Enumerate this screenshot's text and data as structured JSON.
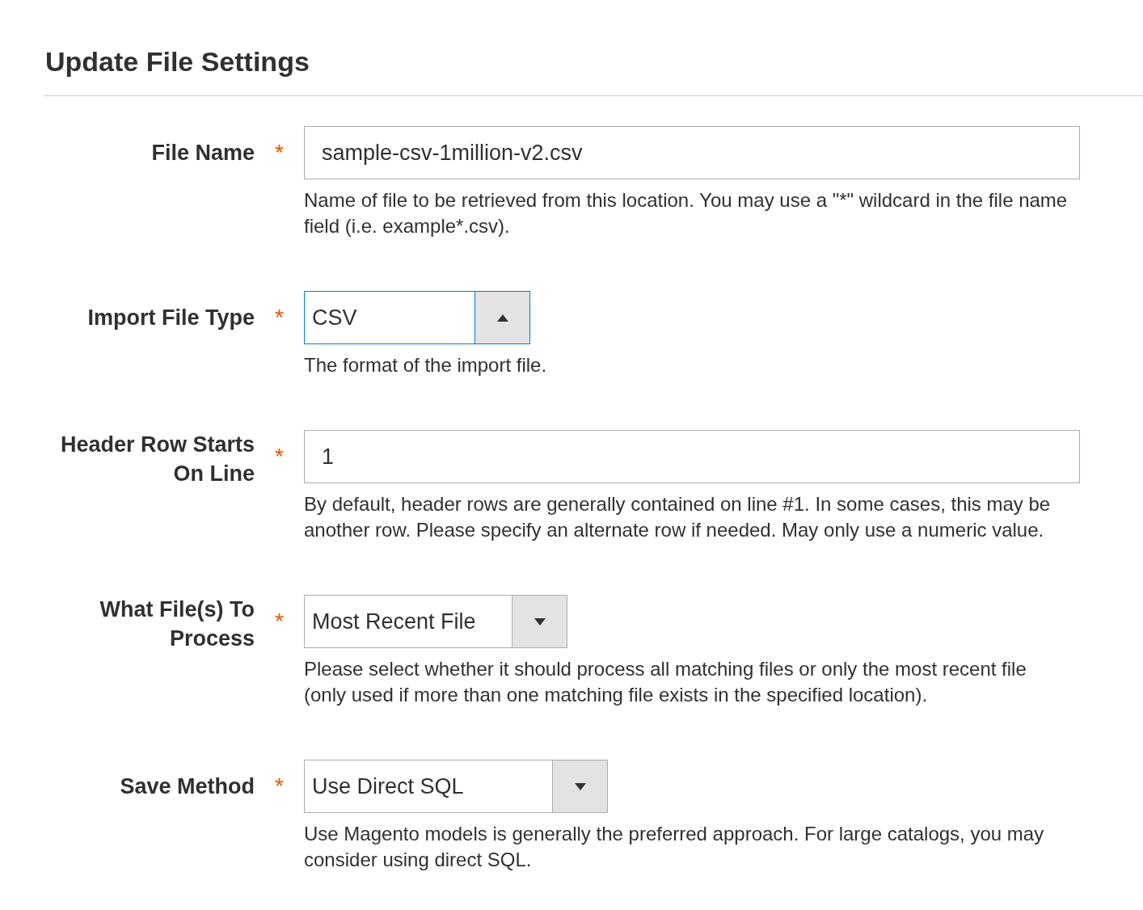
{
  "section": {
    "title": "Update File Settings"
  },
  "fields": [
    {
      "kind": "text",
      "label": "File Name",
      "required": "*",
      "value": "sample-csv-1million-v2.csv",
      "note": "Name of file to be retrieved from this location. You may use a \"*\" wildcard in the file name field (i.e. example*.csv)."
    },
    {
      "kind": "select",
      "label": "Import File Type",
      "required": "*",
      "value": "CSV",
      "expanded": true,
      "note": "The format of the import file."
    },
    {
      "kind": "text",
      "label": "Header Row Starts On Line",
      "required": "*",
      "value": "1",
      "note": "By default, header rows are generally contained on line #1. In some cases, this may be another row. Please specify an alternate row if needed. May only use a numeric value."
    },
    {
      "kind": "select",
      "label": "What File(s) To Process",
      "required": "*",
      "value": "Most Recent File",
      "expanded": false,
      "note": "Please select whether it should process all matching files or only the most recent file (only used if more than one matching file exists in the specified location)."
    },
    {
      "kind": "select",
      "label": "Save Method",
      "required": "*",
      "value": "Use Direct SQL",
      "expanded": false,
      "note": "Use Magento models is generally the preferred approach. For large catalogs, you may consider using direct SQL."
    }
  ]
}
